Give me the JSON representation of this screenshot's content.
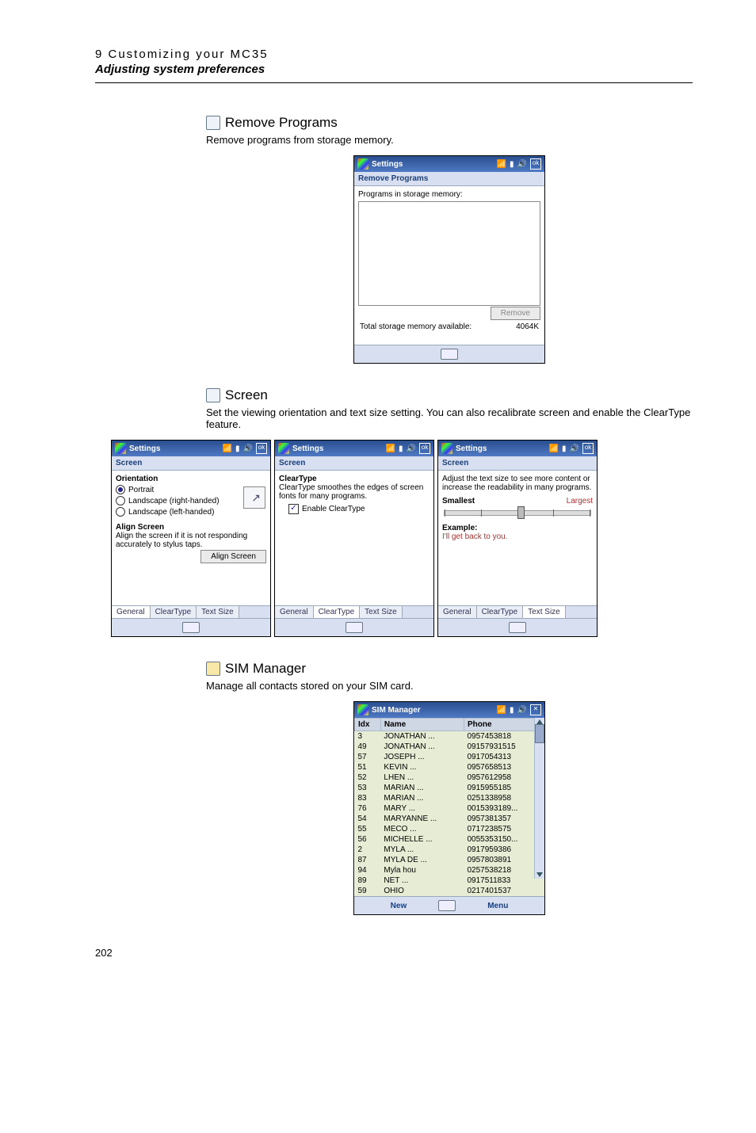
{
  "header": {
    "chapter": "9 Customizing your MC35",
    "section": "Adjusting system preferences"
  },
  "remove_programs": {
    "heading": "Remove Programs",
    "desc": "Remove programs from storage memory.",
    "screen": {
      "title": "Settings",
      "subbar": "Remove Programs",
      "label1": "Programs in storage memory:",
      "remove_btn": "Remove",
      "total_label": "Total storage memory available:",
      "total_value": "4064K",
      "ok": "ok"
    }
  },
  "screen_section": {
    "heading": "Screen",
    "desc": "Set the viewing orientation and text size setting. You can also recalibrate screen and enable the ClearType feature.",
    "s1": {
      "title": "Settings",
      "ok": "ok",
      "subbar": "Screen",
      "orientation": "Orientation",
      "portrait": "Portrait",
      "land_r": "Landscape (right-handed)",
      "land_l": "Landscape (left-handed)",
      "align_h": "Align Screen",
      "align_desc": "Align the screen if it is not responding accurately to stylus taps.",
      "align_btn": "Align Screen",
      "tab_general": "General",
      "tab_clear": "ClearType",
      "tab_text": "Text Size"
    },
    "s2": {
      "title": "Settings",
      "ok": "ok",
      "subbar": "Screen",
      "ct_head": "ClearType",
      "ct_desc": "ClearType smoothes the edges of screen fonts for many programs.",
      "ct_chk": "Enable ClearType",
      "tab_general": "General",
      "tab_clear": "ClearType",
      "tab_text": "Text Size"
    },
    "s3": {
      "title": "Settings",
      "ok": "ok",
      "subbar": "Screen",
      "adj": "Adjust the text size to see more content or increase the readability in many programs.",
      "smallest": "Smallest",
      "largest": "Largest",
      "example_h": "Example:",
      "example_t": "I'll get back to you.",
      "tab_general": "General",
      "tab_clear": "ClearType",
      "tab_text": "Text Size"
    }
  },
  "sim": {
    "heading": "SIM Manager",
    "desc": "Manage all contacts stored on your SIM card.",
    "screen": {
      "title": "SIM Manager",
      "col_idx": "Idx",
      "col_name": "Name",
      "col_phone": "Phone",
      "footer_new": "New",
      "footer_menu": "Menu",
      "close": "✕",
      "rows": [
        {
          "idx": "3",
          "name": "JONATHAN ...",
          "phone": "0957453818"
        },
        {
          "idx": "49",
          "name": "JONATHAN ...",
          "phone": "09157931515"
        },
        {
          "idx": "57",
          "name": "JOSEPH     ...",
          "phone": "0917054313"
        },
        {
          "idx": "51",
          "name": "KEVIN       ...",
          "phone": "0957658513"
        },
        {
          "idx": "52",
          "name": "LHEN         ...",
          "phone": "0957612958"
        },
        {
          "idx": "53",
          "name": "MARIAN    ...",
          "phone": "0915955185"
        },
        {
          "idx": "83",
          "name": "MARIAN    ...",
          "phone": "0251338958"
        },
        {
          "idx": "76",
          "name": "MARY         ...",
          "phone": "0015393189..."
        },
        {
          "idx": "54",
          "name": "MARYANNE ...",
          "phone": "0957381357"
        },
        {
          "idx": "55",
          "name": "MECO         ...",
          "phone": "0717238575"
        },
        {
          "idx": "56",
          "name": "MICHELLE  ...",
          "phone": "0055353150..."
        },
        {
          "idx": "2",
          "name": "MYLA          ...",
          "phone": "0917959386"
        },
        {
          "idx": "87",
          "name": "MYLA DE   ...",
          "phone": "0957803891"
        },
        {
          "idx": "94",
          "name": "Myla hou",
          "phone": "0257538218"
        },
        {
          "idx": "89",
          "name": "NET            ...",
          "phone": "0917511833"
        },
        {
          "idx": "59",
          "name": "OHIO",
          "phone": "0217401537"
        }
      ]
    }
  },
  "pagenum": "202"
}
